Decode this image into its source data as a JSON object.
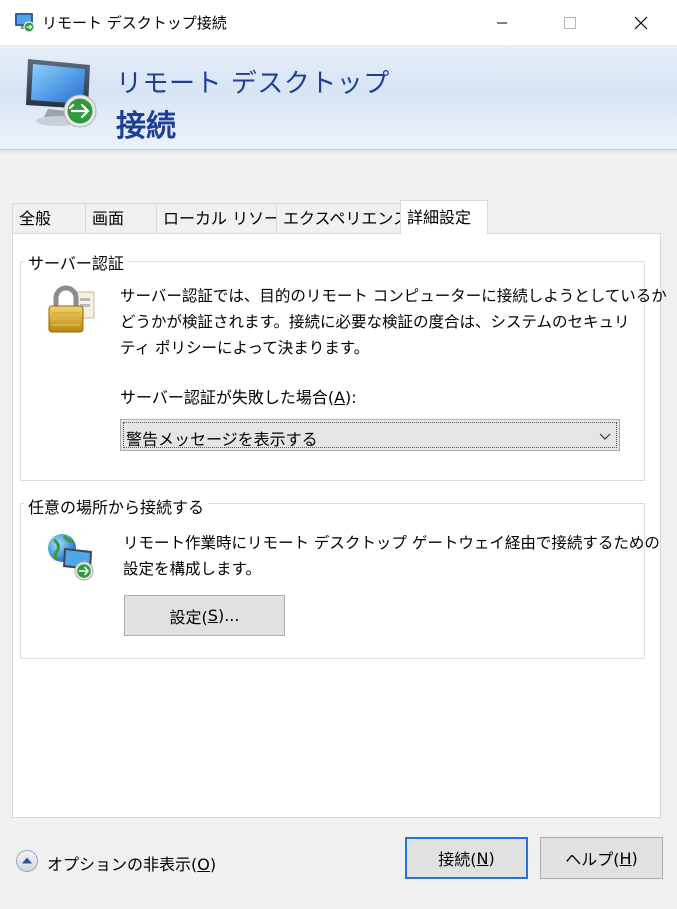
{
  "window": {
    "title": "リモート デスクトップ接続"
  },
  "banner": {
    "line1": "リモート デスクトップ",
    "line2": "接続"
  },
  "tabs": [
    {
      "label": "全般"
    },
    {
      "label": "画面"
    },
    {
      "label": "ローカル リソース"
    },
    {
      "label": "エクスペリエンス"
    },
    {
      "label": "詳細設定",
      "active": true
    }
  ],
  "server_auth": {
    "group_title": "サーバー認証",
    "description_lines": [
      "サーバー認証では、目的のリモート コンピューターに接続しようとしているか",
      "どうかが検証されます。接続に必要な検証の度合は、システムのセキュリ",
      "ティ ポリシーによって決まります。"
    ],
    "fail_label_prefix": "サーバー認証が失敗した場合(",
    "fail_label_key": "A",
    "fail_label_suffix": "):",
    "selected_option": "警告メッセージを表示する"
  },
  "gateway": {
    "group_title": "任意の場所から接続する",
    "description_lines": [
      "リモート作業時にリモート デスクトップ ゲートウェイ経由で接続するための",
      "設定を構成します。"
    ],
    "settings_button": {
      "prefix": "設定(",
      "key": "S",
      "suffix": ")..."
    }
  },
  "footer": {
    "options": {
      "prefix": "オプションの非表示(",
      "key": "O",
      "suffix": ")"
    },
    "connect_button": {
      "prefix": "接続(",
      "key": "N",
      "suffix": ")"
    },
    "help_button": {
      "prefix": "ヘルプ(",
      "key": "H",
      "suffix": ")"
    }
  },
  "icons": {
    "app": "remote-desktop-icon",
    "lock": "padlock-icon",
    "globe": "globe-remote-icon",
    "dropdown": "chevron-down-icon",
    "options": "chevron-up-circle-icon"
  },
  "colors": {
    "banner_text": "#1f3f97",
    "default_button_border": "#1f74d4",
    "window_bg": "#f0f0f0"
  }
}
